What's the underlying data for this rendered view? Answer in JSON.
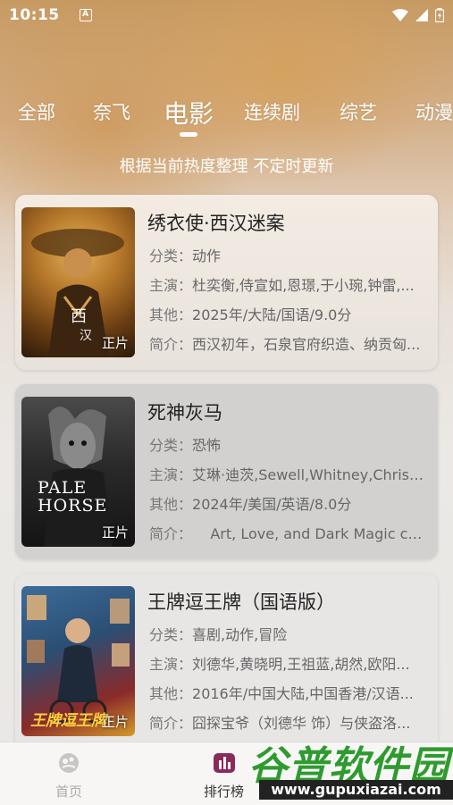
{
  "status_bar": {
    "time": "10:15",
    "notification_icon": "A",
    "icons": [
      "wifi-icon",
      "signal-icon",
      "battery-charging-icon"
    ]
  },
  "tabs": [
    {
      "label": "全部",
      "active": false
    },
    {
      "label": "奈飞",
      "active": false
    },
    {
      "label": "电影",
      "active": true
    },
    {
      "label": "连续剧",
      "active": false
    },
    {
      "label": "综艺",
      "active": false
    },
    {
      "label": "动漫",
      "active": false
    }
  ],
  "subtitle": "根据当前热度整理 不定时更新",
  "labels": {
    "genre": "分类：",
    "cast": "主演：",
    "other": "其他：",
    "intro": "简介："
  },
  "movies": [
    {
      "title": "绣衣使·西汉迷案",
      "genre": "动作",
      "cast": "杜奕衡,侍宣如,恩璟,于小琬,钟雷,...",
      "other": "2025年/大陆/国语/9.0分",
      "intro": "西汉初年，石泉官府织造、纳贡匈...",
      "badge": "正片"
    },
    {
      "title": "死神灰马",
      "genre": "恐怖",
      "cast": "艾琳·迪茨,Sewell,Whitney,Chris,C...",
      "other": "2024年/美国/英语/8.0分",
      "intro": "    Art, Love, and Dark Magic co...",
      "badge": "正片",
      "poster_text": "PALE HORSE"
    },
    {
      "title": "王牌逗王牌（国语版）",
      "genre": "喜剧,动作,冒险",
      "cast": "刘德华,黄晓明,王祖蓝,胡然,欧阳...",
      "other": "2016年/中国大陆,中国香港/汉语...",
      "intro": "囧探宝爷（刘德华 饰）与侠盗洛...",
      "badge": "正片"
    }
  ],
  "bottom_nav": [
    {
      "label": "首页",
      "icon": "home-icon",
      "active": false
    },
    {
      "label": "排行榜",
      "icon": "ranking-icon",
      "active": true
    }
  ],
  "watermark": {
    "brand": "谷普软件园",
    "url": "www.gupuxiazai.com"
  },
  "colors": {
    "accent_header": "#c79a62",
    "text_primary": "#222222",
    "text_secondary": "#666666",
    "watermark_green": "#2f9b2f"
  }
}
